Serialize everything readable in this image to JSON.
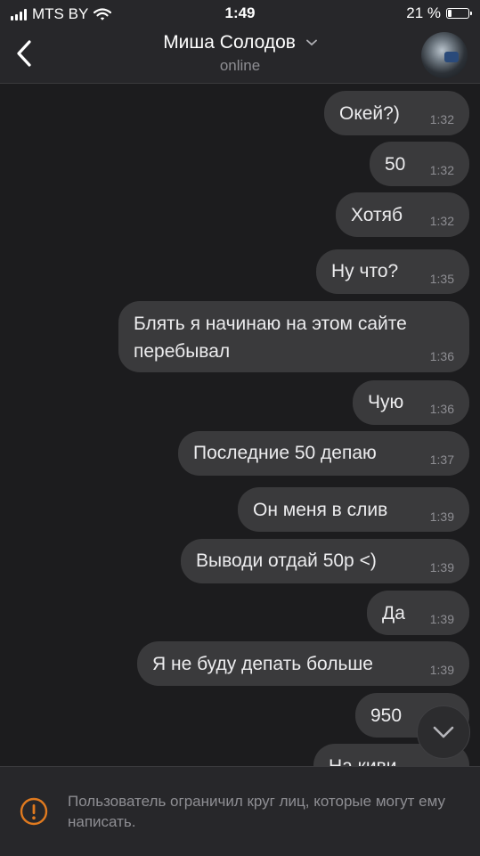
{
  "status_bar": {
    "carrier": "MTS BY",
    "time": "1:49",
    "battery_percent_label": "21 %",
    "battery_level": 0.21
  },
  "header": {
    "contact_name": "Миша Солодов",
    "status": "online"
  },
  "messages": [
    {
      "text": "Окей?)",
      "time": "1:32"
    },
    {
      "text": "50",
      "time": "1:32"
    },
    {
      "text": "Хотяб",
      "time": "1:32"
    },
    {
      "text": "Ну что?",
      "time": "1:35"
    },
    {
      "text_line1": "Блять я начинаю на этом сайте",
      "text_line2": "перебывал",
      "time": "1:36"
    },
    {
      "text": "Чую",
      "time": "1:36"
    },
    {
      "text": "Последние 50 депаю",
      "time": "1:37"
    },
    {
      "text": "Он меня в слив",
      "time": "1:39"
    },
    {
      "text": "Выводи отдай 50р <)",
      "time": "1:39"
    },
    {
      "text": "Да",
      "time": "1:39"
    },
    {
      "text": "Я не буду депать больше",
      "time": "1:39"
    },
    {
      "text": "950",
      "time": ""
    },
    {
      "text": "На киви",
      "time": ""
    }
  ],
  "notice": {
    "text": "Пользователь ограничил круг лиц, которые могут ему написать."
  },
  "colors": {
    "background": "#1c1c1e",
    "bar": "#27272a",
    "bubble": "#3a3a3c",
    "accent_warning": "#e07a1f"
  },
  "icons": [
    "back-chevron-icon",
    "dropdown-chevron-icon",
    "scroll-down-chevron-icon",
    "warning-icon",
    "wifi-icon",
    "signal-icon",
    "battery-icon"
  ]
}
